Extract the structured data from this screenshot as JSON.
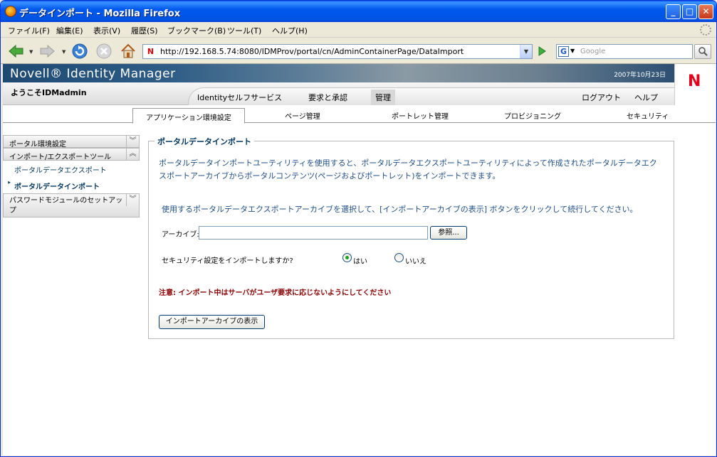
{
  "window": {
    "title": "データインポート - Mozilla Firefox"
  },
  "menu": {
    "items": [
      "ファイル(F)",
      "編集(E)",
      "表示(V)",
      "履歴(S)",
      "ブックマーク(B)",
      "ツール(T)",
      "ヘルプ(H)"
    ]
  },
  "navbar": {
    "url": "http://192.168.5.74:8080/IDMProv/portal/cn/AdminContainerPage/DataImport",
    "search_placeholder": "Google",
    "favicon_letter": "N",
    "search_engine_letter": "G"
  },
  "banner": {
    "brand": "Novell® Identity Manager",
    "date": "2007年10月23日",
    "logo_letter": "N"
  },
  "userbar": {
    "welcome": "ようこそIDMadmin",
    "tabs": [
      "Identityセルフサービス",
      "要求と承認",
      "管理"
    ],
    "logout": "ログアウト",
    "help": "ヘルプ"
  },
  "subnav": {
    "tabs": [
      "アプリケーション環境設定",
      "ページ管理",
      "ポートレット管理",
      "プロビジョニング",
      "セキュリティ"
    ]
  },
  "sidebar": {
    "portal_config": "ポータル環境設定",
    "import_export": "インポート/エクスポートツール",
    "portal_export": "ポータルデータエクスポート",
    "portal_import": "ポータルデータインポート",
    "password_module": "パスワードモジュールのセットアップ"
  },
  "main": {
    "legend": "ポータルデータインポート",
    "description": "ポータルデータインポートユーティリティを使用すると、ポータルデータエクスポートユーティリティによって作成されたポータルデータエクスポートアーカイブからポータルコンテンツ(ページおよびポートレット)をインポートできます。",
    "instruction": "使用するポータルデータエクスポートアーカイブを選択して、[インポートアーカイブの表示] ボタンをクリックして続行してください。",
    "archive_label": "アーカイブ:",
    "archive_value": "",
    "browse_label": "参照...",
    "security_question": "セキュリティ設定をインポートしますか?",
    "yes_label": "はい",
    "no_label": "いいえ",
    "selected": "yes",
    "warning": "注意: インポート中はサーバがユーザ要求に応じないようにしてください",
    "show_archive_button": "インポートアーカイブの表示"
  },
  "colors": {
    "link_blue": "#1f4f85",
    "warning_red": "#8b0000",
    "novell_red": "#e2001a"
  }
}
